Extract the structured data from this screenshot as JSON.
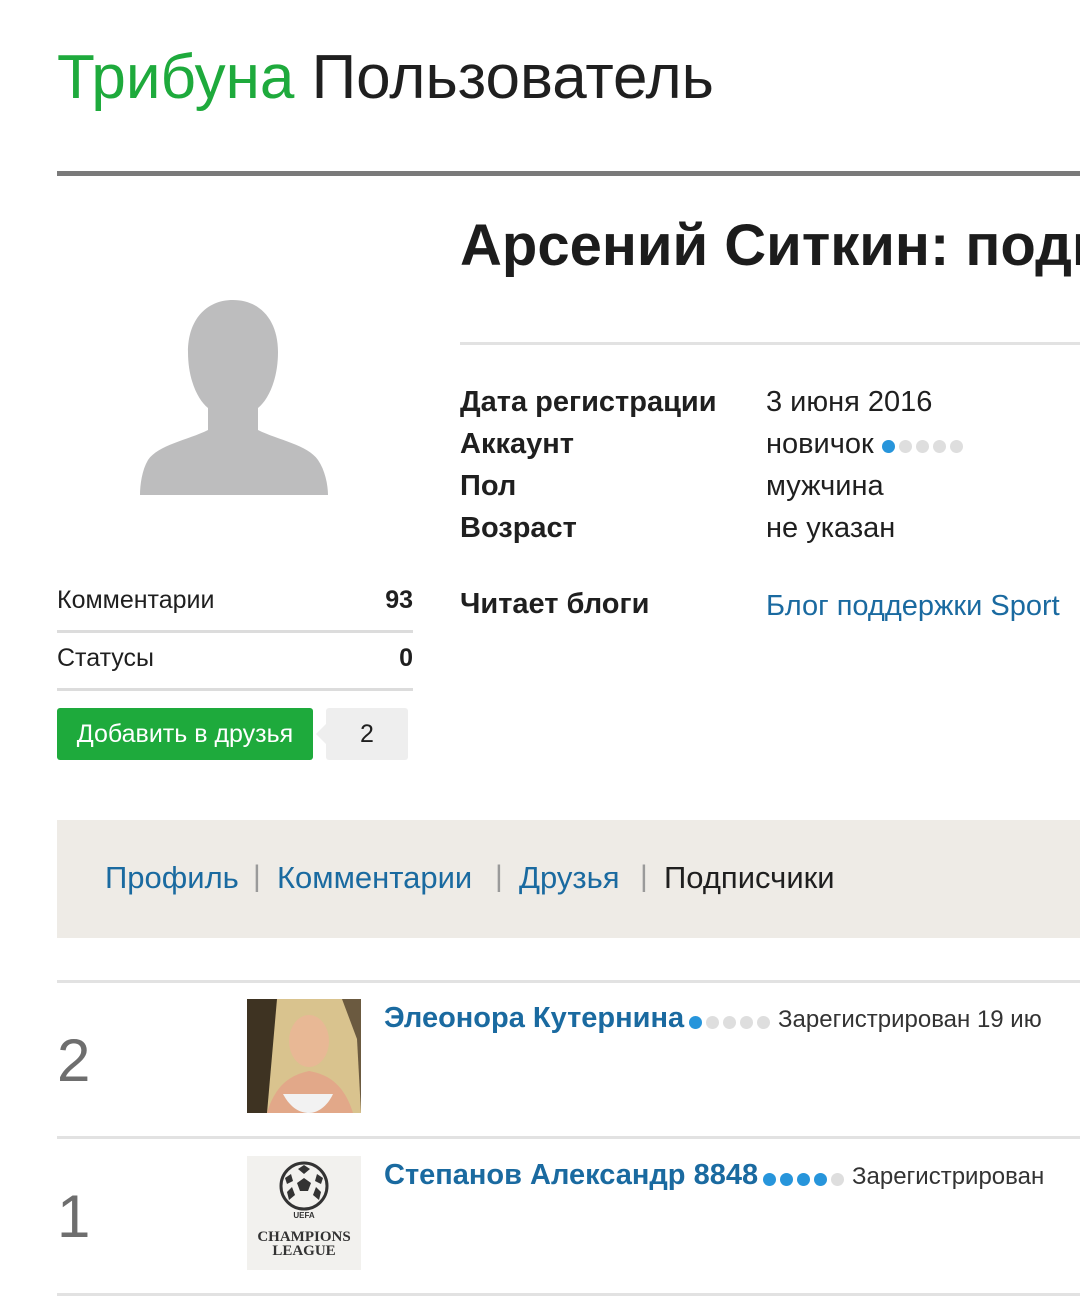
{
  "header": {
    "brand": "Трибуна",
    "title": "Пользователь"
  },
  "profile": {
    "name": "Арсений Ситкин: подп",
    "info": [
      {
        "label": "Дата регистрации",
        "value": "3 июня 2016"
      },
      {
        "label": "Аккаунт",
        "value": "новичок",
        "level": 1,
        "level_max": 5
      },
      {
        "label": "Пол",
        "value": "мужчина"
      },
      {
        "label": "Возраст",
        "value": "не указан"
      }
    ],
    "reads_blogs": {
      "label": "Читает блоги",
      "value": "Блог поддержки Sport"
    }
  },
  "stats": [
    {
      "label": "Комментарии",
      "value": "93"
    },
    {
      "label": "Статусы",
      "value": "0"
    }
  ],
  "friends": {
    "add_label": "Добавить в друзья",
    "count": "2"
  },
  "tabs": [
    "Профиль",
    "Комментарии",
    "Друзья",
    "Подписчики"
  ],
  "active_tab": "Подписчики",
  "subscribers": [
    {
      "num": "2",
      "name": "Элеонора Кутернина",
      "level": 1,
      "reg": "Зарегистрирован 19 ию"
    },
    {
      "num": "1",
      "name": "Степанов Александр 8848",
      "level": 4,
      "reg": "Зарегистрирован",
      "thumb_caption": "CHAMPIONS LEAGUE"
    }
  ],
  "colors": {
    "brand": "#1eaa3c",
    "link": "#1a6aa0",
    "level_dot": "#2795db",
    "tabbar_bg": "#eeebe6"
  }
}
